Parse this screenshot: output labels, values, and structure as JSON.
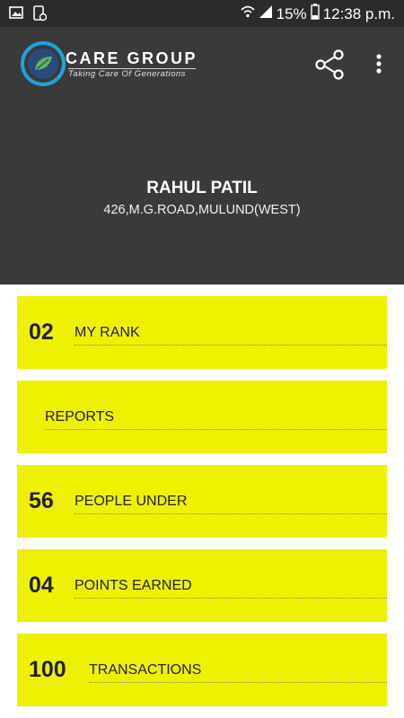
{
  "status_bar": {
    "battery": "15%",
    "time": "12:38 p.m."
  },
  "header": {
    "brand": "CARE GROUP",
    "tagline": "Taking Care Of Generations",
    "icons": [
      "share-icon",
      "more-vert-icon"
    ],
    "colors": {
      "header_bg": "#3a3a3a",
      "logo_ring": "#1fa3dc",
      "logo_leaf": "#5cb85c"
    }
  },
  "profile": {
    "name": "RAHUL PATIL",
    "address": "426,M.G.ROAD,MULUND(WEST)"
  },
  "cards": [
    {
      "number": "02",
      "label": "MY RANK"
    },
    {
      "number": "",
      "label": "REPORTS"
    },
    {
      "number": "56",
      "label": "PEOPLE UNDER"
    },
    {
      "number": "04",
      "label": "POINTS EARNED"
    },
    {
      "number": "100",
      "label": "TRANSACTIONS"
    }
  ],
  "colors": {
    "card_bg": "#eef200"
  }
}
